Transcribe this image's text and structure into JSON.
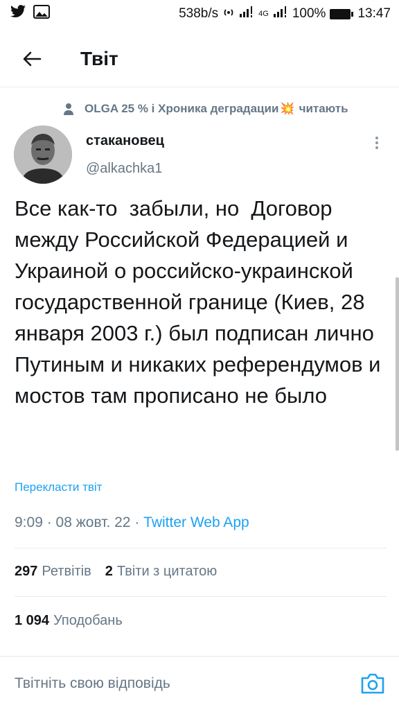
{
  "status_bar": {
    "speed": "538b/s",
    "network": "4G",
    "battery": "100%",
    "time": "13:47"
  },
  "header": {
    "title": "Твіт"
  },
  "social_context": {
    "prefix": "OLGA 25 % і Хроника деградации",
    "emoji": "💥",
    "suffix": "читають"
  },
  "tweet": {
    "display_name": "стакановец",
    "username": "@alkachka1",
    "text": "Все как-то  забыли, но  Договор между Российской Федерацией и Украиной о российско-украинской государственной границе (Киев, 28 января 2003 г.) был подписан лично Путиным и никаких референдумов и мостов там прописано не было",
    "translate_label": "Перекласти твіт",
    "time": "9:09",
    "date": "08 жовт. 22",
    "source": "Twitter Web App",
    "retweets_count": "297",
    "retweets_label": "Ретвітів",
    "quotes_count": "2",
    "quotes_label": "Твіти з цитатою",
    "likes_count": "1 094",
    "likes_label": "Уподобань"
  },
  "reply": {
    "placeholder": "Твітніть свою відповідь"
  },
  "colors": {
    "accent": "#1da1f2",
    "secondary_text": "#657786",
    "primary_text": "#14171a"
  }
}
